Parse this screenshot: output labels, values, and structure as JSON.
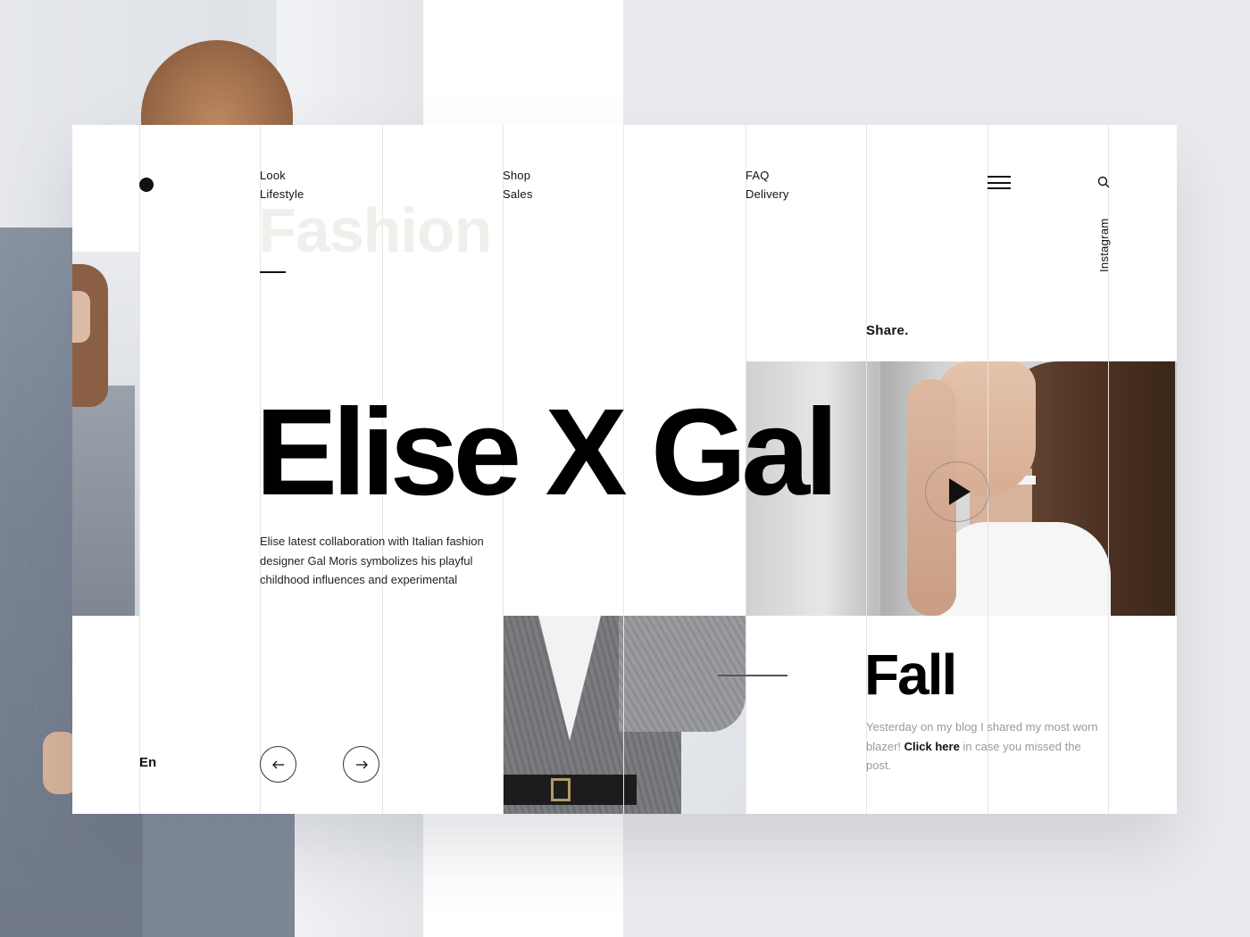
{
  "brand": {
    "logo_icon": "dot-logo-icon"
  },
  "nav": {
    "groups": [
      {
        "links": [
          "Look",
          "Lifestyle"
        ]
      },
      {
        "links": [
          "Shop",
          "Sales"
        ]
      },
      {
        "links": [
          "FAQ",
          "Delivery"
        ]
      }
    ]
  },
  "header": {
    "menu_icon": "hamburger-menu-icon",
    "search_icon": "search-icon"
  },
  "side": {
    "instagram": "Instagram",
    "share": "Share."
  },
  "hero": {
    "watermark": "Fashion",
    "title": "Elise X Gal",
    "intro": "Elise latest collaboration with Italian fashion designer Gal Moris symbolizes his playful childhood influences and experimental"
  },
  "feature": {
    "title": "Fall",
    "text_before": "Yesterday on my blog I shared my most worn blazer!",
    "link": "Click here",
    "text_after": "in case you missed the post."
  },
  "footer": {
    "language": "En",
    "prev_icon": "arrow-left-icon",
    "next_icon": "arrow-right-icon"
  },
  "colors": {
    "background": "#ebebef",
    "card": "#ffffff",
    "text": "#111111",
    "muted": "#9a9a9a",
    "watermark": "#efefeb"
  }
}
